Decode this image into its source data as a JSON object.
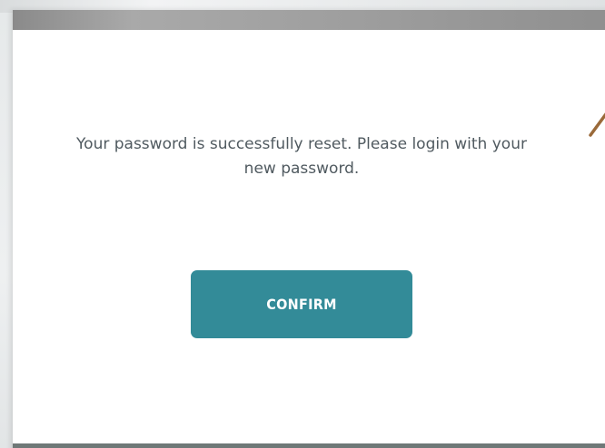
{
  "dialog": {
    "message": "Your password is successfully reset. Please login with your new password.",
    "confirm_label": "CONFIRM"
  },
  "colors": {
    "primary_button": "#338b98",
    "message_text": "#505a60",
    "header_bar": "#9d9d9d",
    "footer_bar": "#6f7877",
    "accent_stroke": "#9a6a3a"
  }
}
